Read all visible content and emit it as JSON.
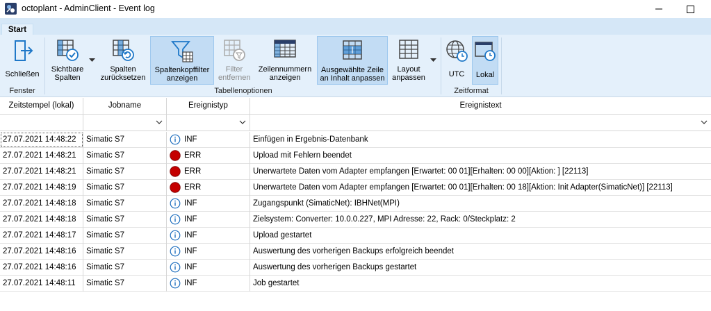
{
  "window": {
    "title": "octoplant - AdminClient - Event log"
  },
  "ribbon": {
    "tab": "Start",
    "groups": {
      "fenster": "Fenster",
      "tabellenoptionen": "Tabellenoptionen",
      "zeitformat": "Zeitformat"
    },
    "buttons": {
      "schliessen": "Schließen",
      "sichtbare_spalten": "Sichtbare\nSpalten",
      "spalten_zuruecksetzen": "Spalten\nzurücksetzen",
      "spaltenkopffilter": "Spaltenkopffilter\nanzeigen",
      "filter_entfernen": "Filter\nentfernen",
      "zeilennummern": "Zeilennummern\nanzeigen",
      "zeile_anpassen": "Ausgewählte Zeile\nan Inhalt anpassen",
      "layout_anpassen": "Layout\nanpassen",
      "utc": "UTC",
      "lokal": "Lokal"
    }
  },
  "colors": {
    "accent": "#1f78c8",
    "selected_bg": "#c2dcf4",
    "error": "#c40000",
    "info": "#1f6fbf"
  },
  "table": {
    "columns": [
      "Zeitstempel (lokal)",
      "Jobname",
      "Ereignistyp",
      "Ereignistext"
    ],
    "rows": [
      {
        "time": "27.07.2021 14:48:22",
        "job": "Simatic S7",
        "type": "INF",
        "icon": "info-icon",
        "text": "Einfügen in Ergebnis-Datenbank"
      },
      {
        "time": "27.07.2021 14:48:21",
        "job": "Simatic S7",
        "type": "ERR",
        "icon": "error-icon",
        "text": "Upload mit Fehlern beendet"
      },
      {
        "time": "27.07.2021 14:48:21",
        "job": "Simatic S7",
        "type": "ERR",
        "icon": "error-icon",
        "text": "Unerwartete Daten vom Adapter empfangen [Erwartet: 00 01][Erhalten: 00 00][Aktion: ] [22113]"
      },
      {
        "time": "27.07.2021 14:48:19",
        "job": "Simatic S7",
        "type": "ERR",
        "icon": "error-icon",
        "text": "Unerwartete Daten vom Adapter empfangen [Erwartet: 00 01][Erhalten: 00 18][Aktion: Init Adapter(SimaticNet)] [22113]"
      },
      {
        "time": "27.07.2021 14:48:18",
        "job": "Simatic S7",
        "type": "INF",
        "icon": "info-icon",
        "text": "Zugangspunkt (SimaticNet): IBHNet(MPI)"
      },
      {
        "time": "27.07.2021 14:48:18",
        "job": "Simatic S7",
        "type": "INF",
        "icon": "info-icon",
        "text": "Zielsystem: Converter: 10.0.0.227, MPI Adresse: 22, Rack: 0/Steckplatz: 2"
      },
      {
        "time": "27.07.2021 14:48:17",
        "job": "Simatic S7",
        "type": "INF",
        "icon": "info-icon",
        "text": "Upload gestartet"
      },
      {
        "time": "27.07.2021 14:48:16",
        "job": "Simatic S7",
        "type": "INF",
        "icon": "info-icon",
        "text": "Auswertung des vorherigen Backups erfolgreich beendet"
      },
      {
        "time": "27.07.2021 14:48:16",
        "job": "Simatic S7",
        "type": "INF",
        "icon": "info-icon",
        "text": "Auswertung des vorherigen Backups gestartet"
      },
      {
        "time": "27.07.2021 14:48:11",
        "job": "Simatic S7",
        "type": "INF",
        "icon": "info-icon",
        "text": "Job gestartet"
      }
    ]
  }
}
